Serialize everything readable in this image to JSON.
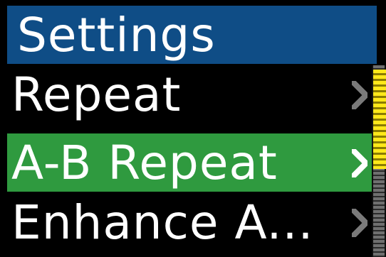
{
  "header": {
    "title": "Settings"
  },
  "menu": {
    "items": [
      {
        "label": "Repeat",
        "selected": false,
        "chevron_icon": "chevron-right-icon"
      },
      {
        "label": "A-B Repeat",
        "selected": true,
        "chevron_icon": "chevron-right-icon"
      },
      {
        "label": "Enhance A...",
        "selected": false,
        "chevron_icon": "chevron-right-icon"
      }
    ]
  },
  "scrollbar": {
    "position_fraction": 0.0,
    "visible_fraction": 0.5
  },
  "colors": {
    "header_background": "#0f4d86",
    "selected_background": "#2f9a3f",
    "text": "#ffffff",
    "scroll_thumb": "#ffe81a",
    "chevron_default": "#7a7a7a",
    "chevron_selected": "#ffffff"
  }
}
